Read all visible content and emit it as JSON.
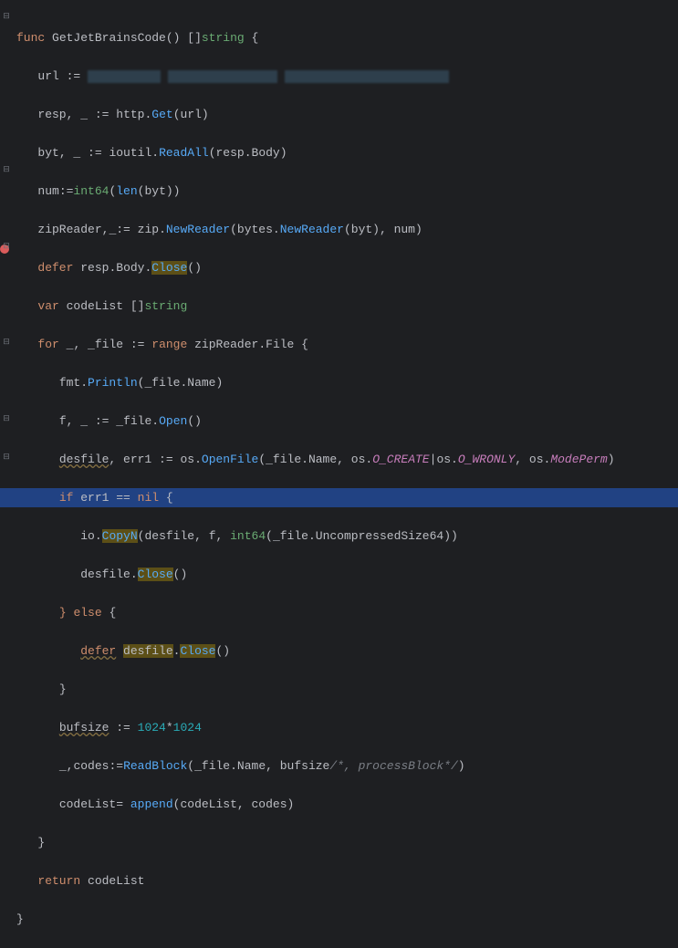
{
  "code": {
    "l1": {
      "kw1": "func",
      "fn": "GetJetBrainsCode",
      "p": "() []",
      "ty": "string",
      "br": " {"
    },
    "l2": {
      "id": "url",
      "op": " := "
    },
    "l3": {
      "id1": "resp",
      "c1": ", ",
      "id2": "_",
      "op": " := ",
      "pkg": "http",
      "d": ".",
      "call": "Get",
      "p1": "(",
      "arg": "url",
      "p2": ")"
    },
    "l4": {
      "id1": "byt",
      "c1": ", ",
      "id2": "_",
      "op": " := ",
      "pkg": "ioutil",
      "d": ".",
      "call": "ReadAll",
      "p1": "(",
      "a1": "resp",
      "d2": ".",
      "a2": "Body",
      "p2": ")"
    },
    "l5": {
      "id": "num",
      "op": ":=",
      "ty": "int64",
      "p1": "(",
      "call": "len",
      "p2": "(",
      "arg": "byt",
      "p3": "))"
    },
    "l6": {
      "id1": "zipReader",
      "c1": ",",
      "id2": "_",
      "op": ":= ",
      "pkg1": "zip",
      "d1": ".",
      "call1": "NewReader",
      "p1": "(",
      "pkg2": "bytes",
      "d2": ".",
      "call2": "NewReader",
      "p2": "(",
      "a1": "byt",
      "p3": "), ",
      "a2": "num",
      "p4": ")"
    },
    "l7": {
      "kw": "defer",
      "sp": " ",
      "a1": "resp",
      "d1": ".",
      "a2": "Body",
      "d2": ".",
      "call": "Close",
      "p": "()"
    },
    "l8": {
      "kw": "var",
      "sp": " ",
      "id": "codeList",
      "sp2": " []",
      "ty": "string"
    },
    "l9": {
      "kw1": "for",
      "sp": " ",
      "u": "_",
      "c": ", ",
      "id": "_file",
      "op": " := ",
      "kw2": "range",
      "sp2": " ",
      "a1": "zipReader",
      "d": ".",
      "a2": "File",
      "br": " {"
    },
    "l10": {
      "pkg": "fmt",
      "d": ".",
      "call": "Println",
      "p1": "(",
      "a1": "_file",
      "d2": ".",
      "a2": "Name",
      "p2": ")"
    },
    "l11": {
      "id1": "f",
      "c": ", ",
      "id2": "_",
      "op": " := ",
      "a1": "_file",
      "d": ".",
      "call": "Open",
      "p": "()"
    },
    "l12": {
      "id1": "desfile",
      "c": ", ",
      "id2": "err1",
      "op": " := ",
      "pkg": "os",
      "d": ".",
      "call": "OpenFile",
      "p1": "(",
      "a1": "_file",
      "d2": ".",
      "a2": "Name",
      "c2": ", ",
      "pkg2": "os",
      "d3": ".",
      "cn1": "O_CREATE",
      "pipe": "|",
      "pkg3": "os",
      "d4": ".",
      "cn2": "O_WRONLY",
      "c3": ", ",
      "pkg4": "os",
      "d5": ".",
      "cn3": "ModePerm",
      "p2": ")"
    },
    "l13": {
      "kw": "if",
      "sp": " ",
      "id": "err1",
      "op": " == ",
      "nil": "nil",
      "br": " {"
    },
    "l14": {
      "pkg": "io",
      "d": ".",
      "call": "CopyN",
      "p1": "(",
      "a1": "desfile",
      "c1": ", ",
      "a2": "f",
      "c2": ", ",
      "ty": "int64",
      "p2": "(",
      "a3": "_file",
      "d2": ".",
      "a4": "UncompressedSize64",
      "p3": "))"
    },
    "l15": {
      "a1": "desfile",
      "d": ".",
      "call": "Close",
      "p": "()"
    },
    "l16": {
      "br1": "}",
      "sp": " ",
      "kw": "else",
      "br2": " {"
    },
    "l17": {
      "kw": "defer",
      "sp": " ",
      "a1": "desfile",
      "d": ".",
      "call": "Close",
      "p": "()"
    },
    "l18": {
      "br": "}"
    },
    "l19": {
      "id": "bufsize",
      "op": " := ",
      "n1": "1024",
      "mul": "*",
      "n2": "1024"
    },
    "l20": {
      "u": "_",
      "c": ",",
      "id": "codes",
      "op": ":=",
      "call": "ReadBlock",
      "p1": "(",
      "a1": "_file",
      "d": ".",
      "a2": "Name",
      "c2": ", ",
      "a3": "bufsize",
      "cm": "/*, processBlock*/",
      "p2": ")"
    },
    "l21": {
      "id": "codeList",
      "op": "= ",
      "call": "append",
      "p1": "(",
      "a1": "codeList",
      "c": ", ",
      "a2": "codes",
      "p2": ")"
    },
    "l22": {
      "br": "}"
    },
    "l23": {
      "kw": "return",
      "sp": " ",
      "id": "codeList"
    },
    "l24": {
      "br": "}"
    }
  },
  "gutter": {
    "fold": "⊟"
  }
}
